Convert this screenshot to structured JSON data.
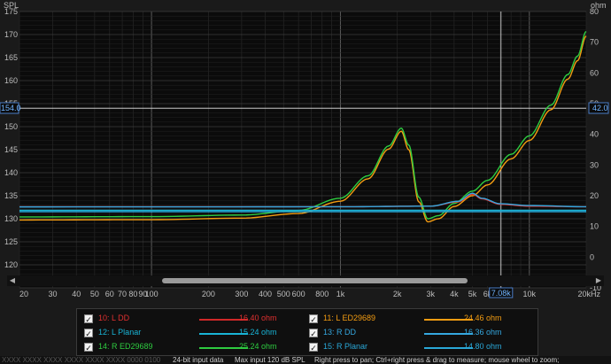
{
  "chart_data": {
    "type": "line",
    "ylabel_left": "SPL",
    "ylabel_right": "ohm",
    "xunit": "kHz",
    "xlim": [
      20,
      20000
    ],
    "ylim_left": [
      115,
      175
    ],
    "ylim_right": [
      -10,
      80
    ],
    "x_log": true,
    "grid": true,
    "x_ticks": [
      {
        "v": 20,
        "t": "20"
      },
      {
        "v": 30,
        "t": "30"
      },
      {
        "v": 40,
        "t": "40"
      },
      {
        "v": 50,
        "t": "50"
      },
      {
        "v": 60,
        "t": "60"
      },
      {
        "v": 70,
        "t": "70"
      },
      {
        "v": 80,
        "t": "80"
      },
      {
        "v": 90,
        "t": "90"
      },
      {
        "v": 100,
        "t": "100"
      },
      {
        "v": 200,
        "t": "200"
      },
      {
        "v": 300,
        "t": "300"
      },
      {
        "v": 400,
        "t": "400"
      },
      {
        "v": 500,
        "t": "500"
      },
      {
        "v": 600,
        "t": "600"
      },
      {
        "v": 800,
        "t": "800"
      },
      {
        "v": 1000,
        "t": "1k"
      },
      {
        "v": 2000,
        "t": "2k"
      },
      {
        "v": 3000,
        "t": "3k"
      },
      {
        "v": 4000,
        "t": "4k"
      },
      {
        "v": 5000,
        "t": "5k"
      },
      {
        "v": 6000,
        "t": "6k"
      },
      {
        "v": 10000,
        "t": "10k"
      },
      {
        "v": 20000,
        "t": "20kHz"
      }
    ],
    "y_ticks_left": [
      "175",
      "170",
      "165",
      "160",
      "155",
      "150",
      "145",
      "140",
      "135",
      "130",
      "125",
      "120"
    ],
    "y_ticks_right": [
      "80",
      "70",
      "60",
      "50",
      "40",
      "30",
      "20",
      "10",
      "0",
      "-10"
    ],
    "cursor": {
      "spl": "154.0",
      "ohm": "42.0",
      "freq": "7.08k",
      "freq_value": 7080
    },
    "series": [
      {
        "name": "L ED29689",
        "axis": "right",
        "color": "#f39c12",
        "points": [
          [
            20,
            12.1
          ],
          [
            100,
            12.2
          ],
          [
            300,
            12.7
          ],
          [
            600,
            14.2
          ],
          [
            1000,
            18.2
          ],
          [
            1400,
            25.5
          ],
          [
            1800,
            35.2
          ],
          [
            2100,
            41.0
          ],
          [
            2300,
            35.0
          ],
          [
            2600,
            18.0
          ],
          [
            2900,
            11.5
          ],
          [
            3300,
            12.5
          ],
          [
            4000,
            16.5
          ],
          [
            5000,
            20.0
          ],
          [
            6000,
            23.5
          ],
          [
            8000,
            32.0
          ],
          [
            10000,
            38.0
          ],
          [
            13000,
            48.0
          ],
          [
            16000,
            58.0
          ],
          [
            18000,
            64.0
          ],
          [
            20000,
            72.0
          ]
        ]
      },
      {
        "name": "R ED29689",
        "axis": "right",
        "color": "#2ecc40",
        "points": [
          [
            20,
            13.1
          ],
          [
            100,
            13.2
          ],
          [
            300,
            13.7
          ],
          [
            600,
            15.2
          ],
          [
            1000,
            19.2
          ],
          [
            1400,
            26.5
          ],
          [
            1800,
            36.2
          ],
          [
            2100,
            42.0
          ],
          [
            2300,
            36.5
          ],
          [
            2600,
            19.5
          ],
          [
            2900,
            12.5
          ],
          [
            3300,
            13.5
          ],
          [
            4000,
            17.5
          ],
          [
            5000,
            21.5
          ],
          [
            6000,
            25.0
          ],
          [
            8000,
            33.5
          ],
          [
            10000,
            39.5
          ],
          [
            13000,
            49.5
          ],
          [
            16000,
            59.5
          ],
          [
            18000,
            65.5
          ],
          [
            20000,
            73.5
          ]
        ]
      },
      {
        "name": "L DD",
        "axis": "right",
        "color": "#e03030",
        "points": [
          [
            20,
            16.4
          ],
          [
            1000,
            16.4
          ],
          [
            3000,
            16.6
          ],
          [
            4200,
            18.0
          ],
          [
            5000,
            20.5
          ],
          [
            5600,
            19.0
          ],
          [
            7000,
            17.2
          ],
          [
            10000,
            16.6
          ],
          [
            20000,
            16.4
          ]
        ]
      },
      {
        "name": "R DD",
        "axis": "right",
        "color": "#35a8e0",
        "points": [
          [
            20,
            16.36
          ],
          [
            1000,
            16.4
          ],
          [
            3000,
            16.6
          ],
          [
            4200,
            18.2
          ],
          [
            5000,
            20.8
          ],
          [
            5600,
            19.2
          ],
          [
            7000,
            17.4
          ],
          [
            10000,
            16.8
          ],
          [
            20000,
            16.4
          ]
        ]
      },
      {
        "name": "L Planar",
        "axis": "right",
        "color": "#19b4d6",
        "points": [
          [
            20,
            15.24
          ],
          [
            20000,
            15.24
          ]
        ]
      },
      {
        "name": "R Planar",
        "axis": "right",
        "color": "#2aa8d8",
        "points": [
          [
            20,
            14.8
          ],
          [
            20000,
            14.8
          ]
        ]
      }
    ]
  },
  "legend": {
    "items": [
      {
        "label": "10: L DD",
        "value": "16.40 ohm",
        "color": "#e03030",
        "line": "#d02828"
      },
      {
        "label": "11: L ED29689",
        "value": "24.46 ohm",
        "color": "#f39c12",
        "line": "#f39c12"
      },
      {
        "label": "12: L Planar",
        "value": "15.24 ohm",
        "color": "#19b4d6",
        "line": "#19b4d6"
      },
      {
        "label": "13: R DD",
        "value": "16.36 ohm",
        "color": "#35a8e0",
        "line": "#35a8e0"
      },
      {
        "label": "14: R ED29689",
        "value": "25.24 ohm",
        "color": "#2ecc40",
        "line": "#2ecc40"
      },
      {
        "label": "15: R Planar",
        "value": "14.80 ohm",
        "color": "#2aa8d8",
        "line": "#2aa8d8"
      }
    ],
    "check_glyph": "✓"
  },
  "status": {
    "left": "XXXX XXXX  XXXX XXXX  XXXX XXXX  0000 0100",
    "bits": "24-bit input data",
    "max": "Max input 120 dB SPL",
    "hint": "Right press to pan; Ctrl+right press & drag to measure; mouse wheel to zoom;"
  }
}
